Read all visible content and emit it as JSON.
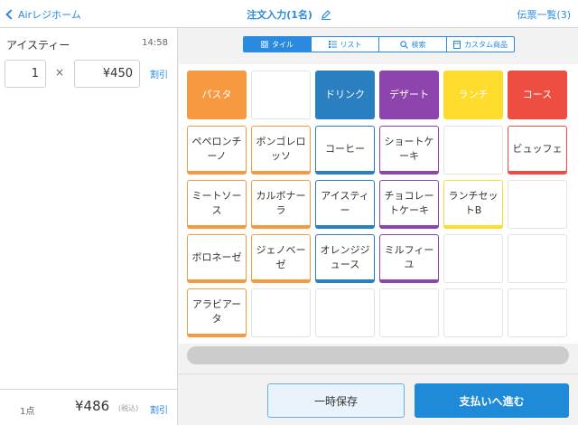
{
  "header": {
    "back_label": "Airレジホーム",
    "title": "注文入力(1名)",
    "right_label": "伝票一覧(3)"
  },
  "order": {
    "item_name": "アイスティー",
    "time": "14:58",
    "quantity": "1",
    "times_symbol": "×",
    "price": "¥450",
    "discount_label": "割引"
  },
  "footer": {
    "count": "1点",
    "total": "¥486",
    "tax_note": "(税込)",
    "discount_label": "割引"
  },
  "view_tabs": [
    {
      "label": "タイル",
      "icon": "grid-icon",
      "active": true
    },
    {
      "label": "リスト",
      "icon": "list-icon",
      "active": false
    },
    {
      "label": "検索",
      "icon": "search-icon",
      "active": false
    },
    {
      "label": "カスタム商品",
      "icon": "calculator-icon",
      "active": false
    }
  ],
  "categories": [
    {
      "label": "パスタ",
      "color": "#f6993f"
    },
    {
      "label": "",
      "color": ""
    },
    {
      "label": "ドリンク",
      "color": "#2a7fc1"
    },
    {
      "label": "デザート",
      "color": "#8e44ad"
    },
    {
      "label": "ランチ",
      "color": "#fddc2b"
    },
    {
      "label": "コース",
      "color": "#ee4d42"
    }
  ],
  "tiles": [
    [
      "ペペロンチーノ",
      "ボンゴレロッソ",
      "コーヒー",
      "ショートケーキ",
      "",
      "ビュッフェ"
    ],
    [
      "ミートソース",
      "カルボナーラ",
      "アイスティー",
      "チョコレートケーキ",
      "ランチセットB",
      ""
    ],
    [
      "ボロネーゼ",
      "ジェノベーゼ",
      "オレンジジュース",
      "ミルフィーユ",
      "",
      ""
    ],
    [
      "アラビアータ",
      "",
      "",
      "",
      "",
      ""
    ]
  ],
  "tile_column_colors": [
    "#f6993f",
    "#f6993f",
    "#2a7fc1",
    "#8e44ad",
    "#fddc2b",
    "#ee4d42"
  ],
  "buttons": {
    "hold_label": "一時保存",
    "pay_label": "支払いへ進む"
  },
  "colors": {
    "accent": "#2a8ae0",
    "pay_button": "#1f8bd8"
  }
}
